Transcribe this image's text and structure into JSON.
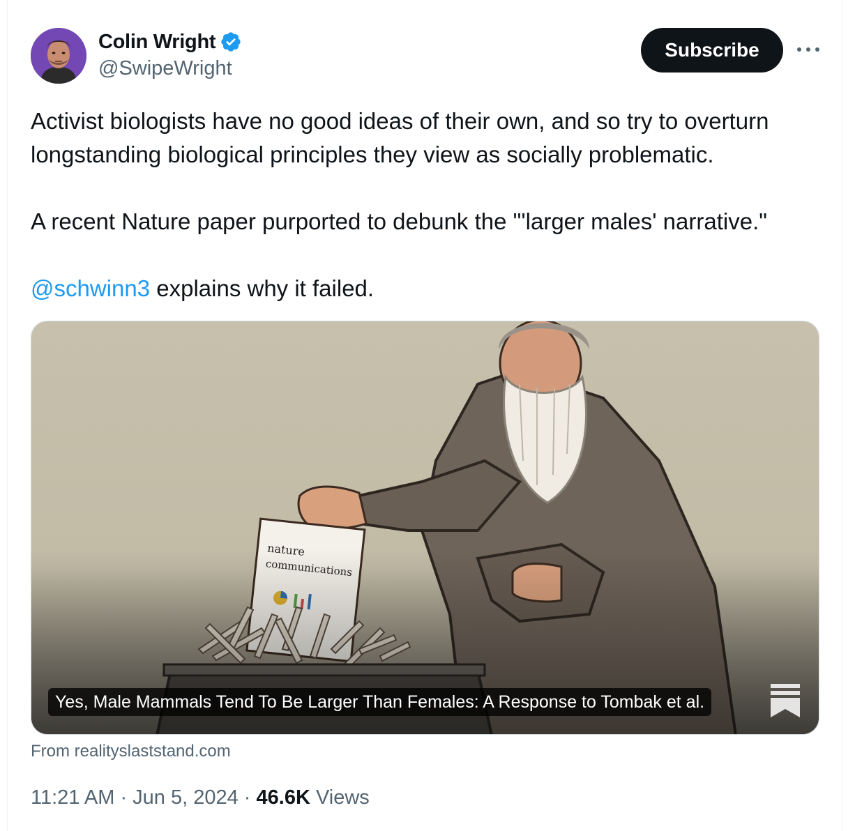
{
  "author": {
    "display_name": "Colin Wright",
    "handle": "@SwipeWright",
    "verified": true,
    "verified_color": "#1d9bf0"
  },
  "actions": {
    "subscribe_label": "Subscribe",
    "more_icon": "more-horizontal-icon"
  },
  "tweet": {
    "paragraphs": [
      "Activist biologists have no good ideas of their own, and so try to overturn longstanding biological principles they view as socially problematic.",
      "A recent Nature paper purported to debunk the \"'larger males' narrative.\""
    ],
    "mention": "@schwinn3",
    "mention_tail": " explains why it failed."
  },
  "card": {
    "title": "Yes, Male Mammals Tend To Be Larger Than Females: A Response to Tombak et al.",
    "paper_text_line1": "nature",
    "paper_text_line2": "communications",
    "bookmark_icon": "substack-icon",
    "source": "From realityslaststand.com"
  },
  "meta": {
    "time": "11:21 AM",
    "separator": " · ",
    "date": "Jun 5, 2024",
    "views_count": "46.6K",
    "views_label": " Views"
  },
  "colors": {
    "text": "#0f1419",
    "secondary": "#536471",
    "link": "#1d9bf0",
    "button_bg": "#0f1419"
  }
}
